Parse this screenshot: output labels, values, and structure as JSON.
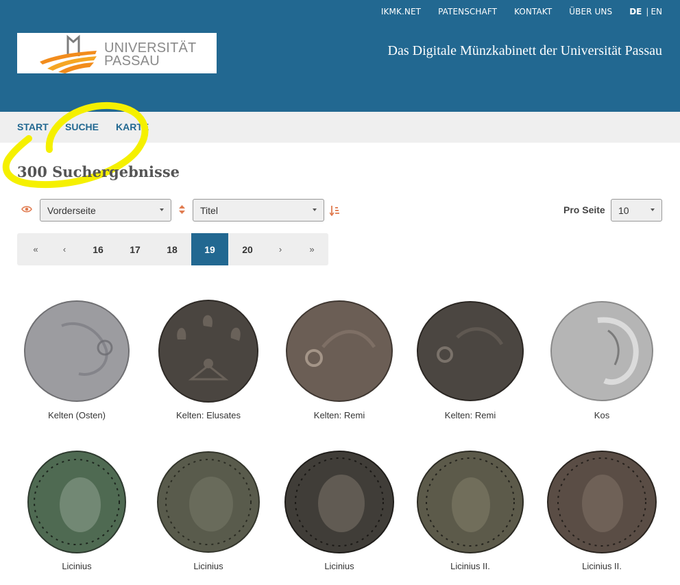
{
  "topnav": {
    "links": [
      "IKMK.NET",
      "PATENSCHAFT",
      "KONTAKT",
      "ÜBER UNS"
    ],
    "lang_de": "DE",
    "lang_sep": "|",
    "lang_en": "EN"
  },
  "logo": {
    "line1": "UNIVERSITÄT",
    "line2": "PASSAU"
  },
  "site_title": "Das Digitale Münzkabinett der Universität Passau",
  "mainnav": [
    "START",
    "SUCHE",
    "KARTE"
  ],
  "results_title": "300 Suchergebnisse",
  "controls": {
    "view_select": "Vorderseite",
    "sort_select": "Titel",
    "per_page_label": "Pro Seite",
    "per_page_value": "10"
  },
  "pagination": {
    "first": "«",
    "prev": "‹",
    "pages": [
      "16",
      "17",
      "18",
      "19",
      "20"
    ],
    "active": "19",
    "next": "›",
    "last": "»"
  },
  "coins": [
    {
      "label": "Kelten (Osten)",
      "tone": "#9c9ca0"
    },
    {
      "label": "Kelten: Elusates",
      "tone": "#4a4540"
    },
    {
      "label": "Kelten: Remi",
      "tone": "#6b5e55"
    },
    {
      "label": "Kelten: Remi",
      "tone": "#4b4641"
    },
    {
      "label": "Kos",
      "tone": "#b5b5b5"
    },
    {
      "label": "Licinius",
      "tone": "#4f6a52"
    },
    {
      "label": "Licinius",
      "tone": "#595b4c"
    },
    {
      "label": "Licinius",
      "tone": "#403d38"
    },
    {
      "label": "Licinius II.",
      "tone": "#5c5a4a"
    },
    {
      "label": "Licinius II.",
      "tone": "#5a4d45"
    }
  ],
  "colors": {
    "header": "#226891",
    "accent": "#e07a4e",
    "highlight": "#f5f000"
  }
}
